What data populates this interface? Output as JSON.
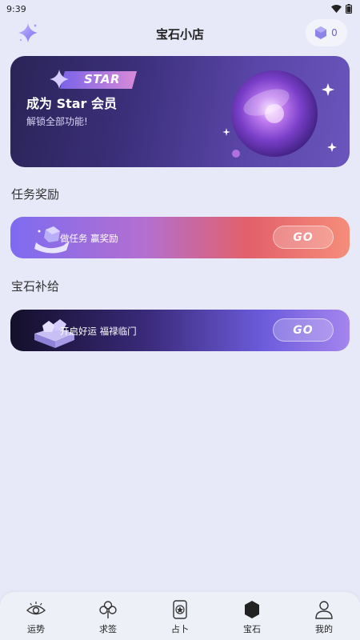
{
  "status_bar": {
    "time": "9:39"
  },
  "header": {
    "title": "宝石小店",
    "gem_count": "0"
  },
  "star_banner": {
    "badge_text": "STAR",
    "title": "成为 Star 会员",
    "subtitle": "解锁全部功能!"
  },
  "sections": [
    {
      "title": "任务奖励",
      "card_label": "做任务 赢奖励",
      "button": "GO"
    },
    {
      "title": "宝石补给",
      "card_label": "开启好运 福禄临门",
      "button": "GO"
    }
  ],
  "bottom_nav": {
    "items": [
      {
        "label": "运势",
        "icon": "eye-icon"
      },
      {
        "label": "求签",
        "icon": "clover-icon"
      },
      {
        "label": "占卜",
        "icon": "tarot-card-icon"
      },
      {
        "label": "宝石",
        "icon": "gem-icon",
        "active": true
      },
      {
        "label": "我的",
        "icon": "person-icon"
      }
    ]
  },
  "colors": {
    "accent": "#6b63c9",
    "background": "#e8e9f8"
  }
}
